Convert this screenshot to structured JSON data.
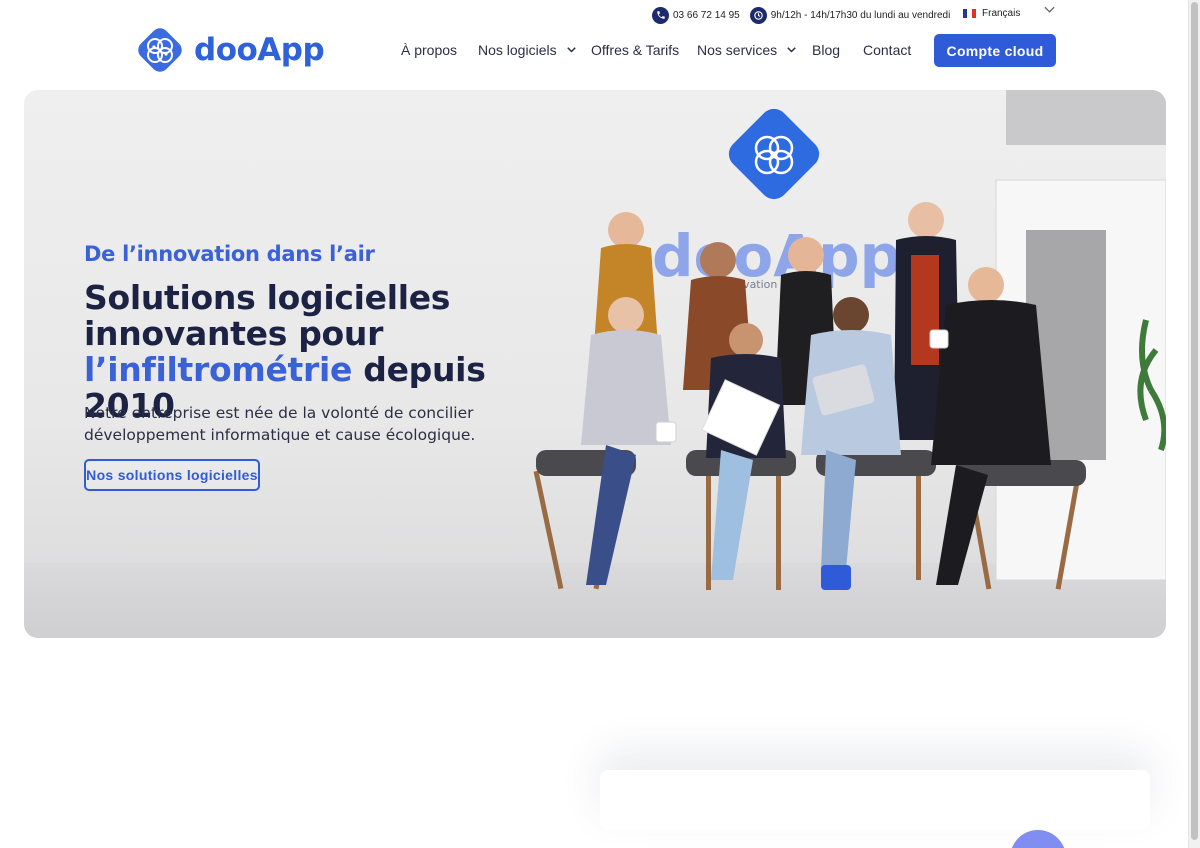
{
  "topbar": {
    "phone": "03 66 72 14 95",
    "phone_icon": "phone-icon",
    "hours": "9h/12h - 14h/17h30 du lundi au vendredi",
    "hours_icon": "clock-icon",
    "language": "Français",
    "language_flag_colors": [
      "#1f3a93",
      "#ffffff",
      "#e2302d"
    ]
  },
  "brand": {
    "name": "dooApp",
    "color": "#2f61d8"
  },
  "nav": {
    "items": [
      {
        "label": "À propos"
      },
      {
        "label": "Nos logiciels"
      },
      {
        "label": "Offres & Tarifs"
      },
      {
        "label": "Nos services"
      },
      {
        "label": "Blog"
      },
      {
        "label": "Contact"
      }
    ],
    "cta": "Compte cloud"
  },
  "hero": {
    "kicker": "De l’innovation dans l’air",
    "title_part1": "Solutions logicielles innovantes pour",
    "title_accent": "l’infiltrométrie",
    "title_part2": "depuis 2010",
    "description": "Notre entreprise est née de la volonté de concilier développement informatique et cause écologique.",
    "button": "Nos solutions logicielles",
    "wall_sign_text": "de l'innovation dans l'air"
  },
  "colors": {
    "primary": "#2f5bd9",
    "accent": "#3a62d6",
    "heading": "#1c2244"
  }
}
